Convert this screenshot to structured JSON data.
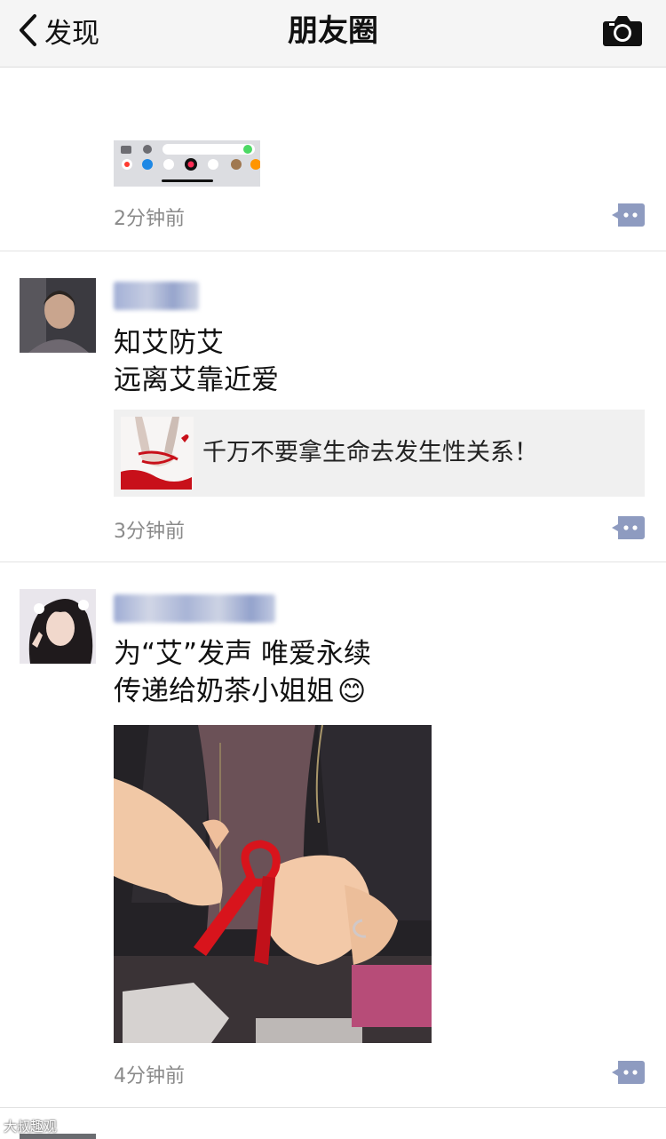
{
  "navbar": {
    "back_label": "发现",
    "title": "朋友圈",
    "camera_icon": "camera-icon"
  },
  "posts": [
    {
      "time": "2分钟前",
      "image_icon": "keyboard-screenshot-thumbnail"
    },
    {
      "lines": [
        "知艾防艾",
        "远离艾靠近爱"
      ],
      "link_title": "千万不要拿生命去发生性关系！",
      "time": "3分钟前"
    },
    {
      "lines": [
        "为“艾”发声  唯爱永续",
        "传递给奶茶小姐姐"
      ],
      "emoji": "😊",
      "time": "4分钟前"
    }
  ],
  "watermark": "大叔趣观",
  "colors": {
    "comment_button": "#8e9bc0",
    "link_card_bg": "#f0f0f0",
    "ribbon": "#d8141c"
  }
}
